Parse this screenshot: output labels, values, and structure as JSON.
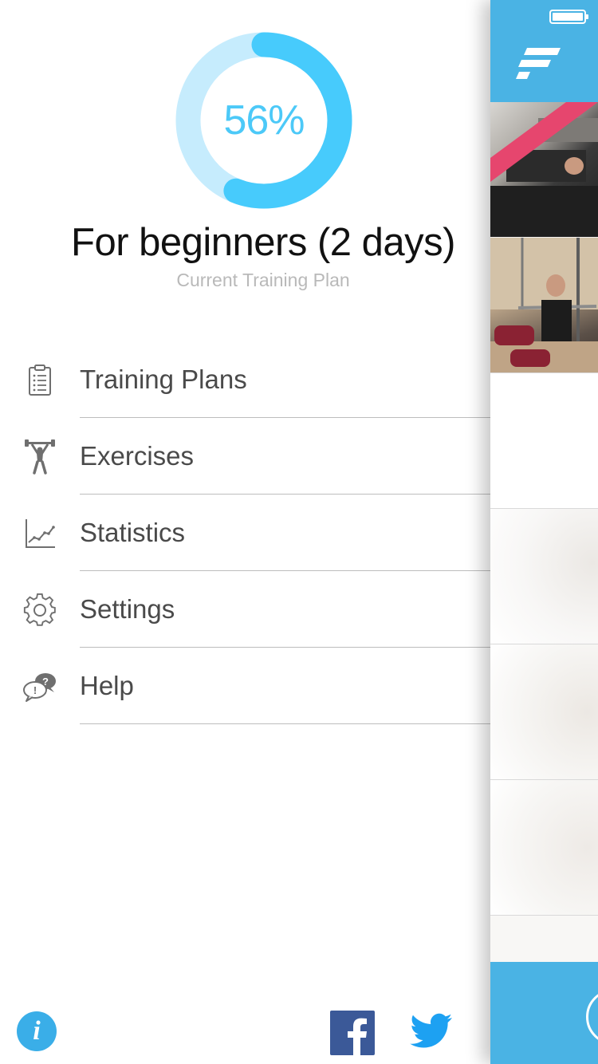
{
  "progress": {
    "percent": 56,
    "label": "56%",
    "track_color": "#c6ecfd",
    "fill_color": "#47cbfc"
  },
  "current_plan": {
    "title": "For beginners (2 days)",
    "subtitle": "Current Training Plan"
  },
  "menu": {
    "items": [
      {
        "id": "training-plans",
        "label": "Training Plans",
        "icon": "clipboard-icon"
      },
      {
        "id": "exercises",
        "label": "Exercises",
        "icon": "weightlifter-icon"
      },
      {
        "id": "statistics",
        "label": "Statistics",
        "icon": "line-chart-icon"
      },
      {
        "id": "settings",
        "label": "Settings",
        "icon": "gear-icon"
      },
      {
        "id": "help",
        "label": "Help",
        "icon": "speech-bubbles-icon"
      }
    ]
  },
  "footer": {
    "info_icon": "info-icon",
    "info_glyph": "i",
    "facebook_icon": "facebook-icon",
    "twitter_icon": "twitter-icon"
  },
  "colors": {
    "accent_blue": "#4ab3e4",
    "info_blue": "#3aaee8",
    "facebook_blue": "#3b5998",
    "twitter_blue": "#1da1f2",
    "menu_text": "#4a4a4a",
    "icon_gray": "#6f6f6f"
  }
}
